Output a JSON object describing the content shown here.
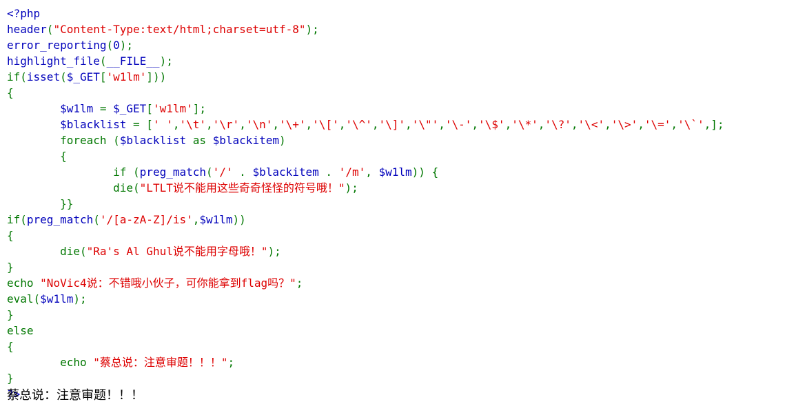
{
  "code_lines": [
    [
      {
        "t": "<?php",
        "c": "def"
      }
    ],
    [
      {
        "t": "header",
        "c": "def"
      },
      {
        "t": "(",
        "c": "kw"
      },
      {
        "t": "\"Content-Type:text/html;charset=utf-8\"",
        "c": "str"
      },
      {
        "t": ");",
        "c": "kw"
      }
    ],
    [
      {
        "t": "error_reporting",
        "c": "def"
      },
      {
        "t": "(",
        "c": "kw"
      },
      {
        "t": "0",
        "c": "def"
      },
      {
        "t": ");",
        "c": "kw"
      }
    ],
    [
      {
        "t": "highlight_file",
        "c": "def"
      },
      {
        "t": "(",
        "c": "kw"
      },
      {
        "t": "__FILE__",
        "c": "def"
      },
      {
        "t": ");",
        "c": "kw"
      }
    ],
    [
      {
        "t": "if(",
        "c": "kw"
      },
      {
        "t": "isset",
        "c": "def"
      },
      {
        "t": "(",
        "c": "kw"
      },
      {
        "t": "$_GET",
        "c": "def"
      },
      {
        "t": "[",
        "c": "kw"
      },
      {
        "t": "'w1lm'",
        "c": "str"
      },
      {
        "t": "]))",
        "c": "kw"
      }
    ],
    [
      {
        "t": "{",
        "c": "kw"
      }
    ],
    [
      {
        "t": "        ",
        "c": "kw"
      },
      {
        "t": "$w1lm ",
        "c": "def"
      },
      {
        "t": "= ",
        "c": "kw"
      },
      {
        "t": "$_GET",
        "c": "def"
      },
      {
        "t": "[",
        "c": "kw"
      },
      {
        "t": "'w1lm'",
        "c": "str"
      },
      {
        "t": "];",
        "c": "kw"
      }
    ],
    [
      {
        "t": "        ",
        "c": "kw"
      },
      {
        "t": "$blacklist ",
        "c": "def"
      },
      {
        "t": "= [",
        "c": "kw"
      },
      {
        "t": "' '",
        "c": "str"
      },
      {
        "t": ",",
        "c": "kw"
      },
      {
        "t": "'\\t'",
        "c": "str"
      },
      {
        "t": ",",
        "c": "kw"
      },
      {
        "t": "'\\r'",
        "c": "str"
      },
      {
        "t": ",",
        "c": "kw"
      },
      {
        "t": "'\\n'",
        "c": "str"
      },
      {
        "t": ",",
        "c": "kw"
      },
      {
        "t": "'\\+'",
        "c": "str"
      },
      {
        "t": ",",
        "c": "kw"
      },
      {
        "t": "'\\['",
        "c": "str"
      },
      {
        "t": ",",
        "c": "kw"
      },
      {
        "t": "'\\^'",
        "c": "str"
      },
      {
        "t": ",",
        "c": "kw"
      },
      {
        "t": "'\\]'",
        "c": "str"
      },
      {
        "t": ",",
        "c": "kw"
      },
      {
        "t": "'\\\"'",
        "c": "str"
      },
      {
        "t": ",",
        "c": "kw"
      },
      {
        "t": "'\\-'",
        "c": "str"
      },
      {
        "t": ",",
        "c": "kw"
      },
      {
        "t": "'\\$'",
        "c": "str"
      },
      {
        "t": ",",
        "c": "kw"
      },
      {
        "t": "'\\*'",
        "c": "str"
      },
      {
        "t": ",",
        "c": "kw"
      },
      {
        "t": "'\\?'",
        "c": "str"
      },
      {
        "t": ",",
        "c": "kw"
      },
      {
        "t": "'\\<'",
        "c": "str"
      },
      {
        "t": ",",
        "c": "kw"
      },
      {
        "t": "'\\>'",
        "c": "str"
      },
      {
        "t": ",",
        "c": "kw"
      },
      {
        "t": "'\\='",
        "c": "str"
      },
      {
        "t": ",",
        "c": "kw"
      },
      {
        "t": "'\\`'",
        "c": "str"
      },
      {
        "t": ",];",
        "c": "kw"
      }
    ],
    [
      {
        "t": "        ",
        "c": "kw"
      },
      {
        "t": "foreach ",
        "c": "kw"
      },
      {
        "t": "(",
        "c": "kw"
      },
      {
        "t": "$blacklist ",
        "c": "def"
      },
      {
        "t": "as ",
        "c": "kw"
      },
      {
        "t": "$blackitem",
        "c": "def"
      },
      {
        "t": ")",
        "c": "kw"
      }
    ],
    [
      {
        "t": "        {",
        "c": "kw"
      }
    ],
    [
      {
        "t": "                ",
        "c": "kw"
      },
      {
        "t": "if ",
        "c": "kw"
      },
      {
        "t": "(",
        "c": "kw"
      },
      {
        "t": "preg_match",
        "c": "def"
      },
      {
        "t": "(",
        "c": "kw"
      },
      {
        "t": "'/' ",
        "c": "str"
      },
      {
        "t": ". ",
        "c": "kw"
      },
      {
        "t": "$blackitem ",
        "c": "def"
      },
      {
        "t": ". ",
        "c": "kw"
      },
      {
        "t": "'/m'",
        "c": "str"
      },
      {
        "t": ", ",
        "c": "kw"
      },
      {
        "t": "$w1lm",
        "c": "def"
      },
      {
        "t": ")) {",
        "c": "kw"
      }
    ],
    [
      {
        "t": "                ",
        "c": "kw"
      },
      {
        "t": "die",
        "c": "kw"
      },
      {
        "t": "(",
        "c": "kw"
      },
      {
        "t": "\"LTLT说不能用这些奇奇怪怪的符号哦！\"",
        "c": "str"
      },
      {
        "t": ");",
        "c": "kw"
      }
    ],
    [
      {
        "t": "        }}",
        "c": "kw"
      }
    ],
    [
      {
        "t": "if(",
        "c": "kw"
      },
      {
        "t": "preg_match",
        "c": "def"
      },
      {
        "t": "(",
        "c": "kw"
      },
      {
        "t": "'/[a-zA-Z]/is'",
        "c": "str"
      },
      {
        "t": ",",
        "c": "kw"
      },
      {
        "t": "$w1lm",
        "c": "def"
      },
      {
        "t": "))",
        "c": "kw"
      }
    ],
    [
      {
        "t": "{",
        "c": "kw"
      }
    ],
    [
      {
        "t": "        ",
        "c": "kw"
      },
      {
        "t": "die",
        "c": "kw"
      },
      {
        "t": "(",
        "c": "kw"
      },
      {
        "t": "\"Ra's Al Ghul说不能用字母哦！\"",
        "c": "str"
      },
      {
        "t": ");",
        "c": "kw"
      }
    ],
    [
      {
        "t": "}",
        "c": "kw"
      }
    ],
    [
      {
        "t": "echo ",
        "c": "kw"
      },
      {
        "t": "\"NoVic4说：不错哦小伙子，可你能拿到flag吗？\"",
        "c": "str"
      },
      {
        "t": ";",
        "c": "kw"
      }
    ],
    [
      {
        "t": "eval",
        "c": "kw"
      },
      {
        "t": "(",
        "c": "kw"
      },
      {
        "t": "$w1lm",
        "c": "def"
      },
      {
        "t": ");",
        "c": "kw"
      }
    ],
    [
      {
        "t": "}",
        "c": "kw"
      }
    ],
    [
      {
        "t": "else",
        "c": "kw"
      }
    ],
    [
      {
        "t": "{",
        "c": "kw"
      }
    ],
    [
      {
        "t": "        ",
        "c": "kw"
      },
      {
        "t": "echo ",
        "c": "kw"
      },
      {
        "t": "\"蔡总说：注意审题！！！\"",
        "c": "str"
      },
      {
        "t": ";",
        "c": "kw"
      }
    ],
    [
      {
        "t": "}",
        "c": "kw"
      }
    ],
    [
      {
        "t": "?>",
        "c": "def"
      }
    ]
  ],
  "output_text": "蔡总说：注意审题！！！"
}
